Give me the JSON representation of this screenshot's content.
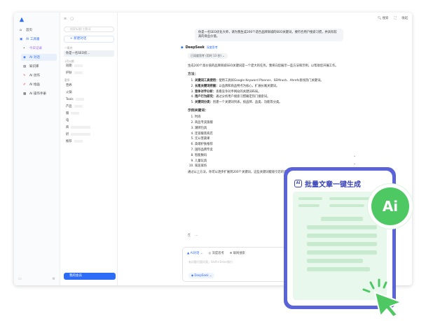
{
  "sidebar": {
    "items": [
      {
        "label": "首页"
      },
      {
        "label": "AI 工具箱"
      },
      {
        "label": "今日记录"
      },
      {
        "label": "AI 对话"
      },
      {
        "label": "知识库"
      },
      {
        "label": "AI 创作"
      },
      {
        "label": "AI 绘画"
      },
      {
        "label": "AI 操作手册"
      }
    ]
  },
  "history": {
    "search_placeholder": "搜索标题/主题词",
    "new_chat": "+ 新建对话",
    "section_today": "一周内",
    "active_item": "你是一名SEO优...",
    "sec2": "1月以前",
    "sec3": "更早",
    "rows": [
      "短期",
      "护肤",
      "营养",
      "火锅",
      "Tools",
      "产品",
      "服",
      "电",
      "商",
      "奶",
      "推荐"
    ],
    "bottom_button": "我的会员"
  },
  "topbar": {
    "search": "搜索",
    "collapse": "收起"
  },
  "chat": {
    "user_message": "你是一名SEO优化大师，请为我生成200个适合品牌商城的SEO关键词，要符合用户搜索习惯，并具有较高的商业价值。",
    "bot_name": "DeepSeek",
    "bot_tag": "深度思考",
    "thinking": "已深度思考 (用时 13 秒)",
    "intro": "生成200个高价值的品牌商城SEO关键词是一个庞大的任务。我将向您展示一些方法和示例，以帮助您开展工作。",
    "methods_title": "方法：",
    "methods": [
      {
        "bold": "关键词工具使用：",
        "text": "使用工具如Google Keyword Planner、SEMrush、Ahrefs查找热门关键词。"
      },
      {
        "bold": "长尾关键词挖掘：",
        "text": "以品牌和商品特点为核心，扩展长尾关键词。"
      },
      {
        "bold": "竞争对手分析：",
        "text": "查看竞争对手网站的关键词布局。"
      },
      {
        "bold": "用户行为研究：",
        "text": "通过分析用户搜索习惯确定热门搜索词。"
      },
      {
        "bold": "关键词分类：",
        "text": "创建一个关键词列表，按品牌、品类、功能等分类。"
      }
    ],
    "examples_title": "示例关键词：",
    "examples": [
      "时尚",
      "商品专卖旗舰",
      "潮牌包具",
      "连锁服装商店",
      "无公害蔬果",
      "高端护肤推荐",
      "国际品牌专卖",
      "智能数码",
      "儿童玩具",
      "家居家纺"
    ],
    "outro": "通过以上方法，你可以逐步扩展到200个关键词。这些关键词能吸引您的目标用户并提高转化率。",
    "feedback_icons": [
      "copy",
      "more"
    ]
  },
  "input": {
    "tool_model": "AI对话",
    "tool_deep": "深度思考",
    "tool_web": "联网搜索",
    "placeholder": "有问题尽管问我，Shift+Enter换行",
    "model_chip": "DeepSeek"
  },
  "card": {
    "title": "批量文章一键生成",
    "logo": "AI"
  },
  "badge": {
    "text": "Ai"
  },
  "colors": {
    "accent": "#2d6cf6",
    "card": "#5a63d8",
    "green": "#4ec862"
  }
}
